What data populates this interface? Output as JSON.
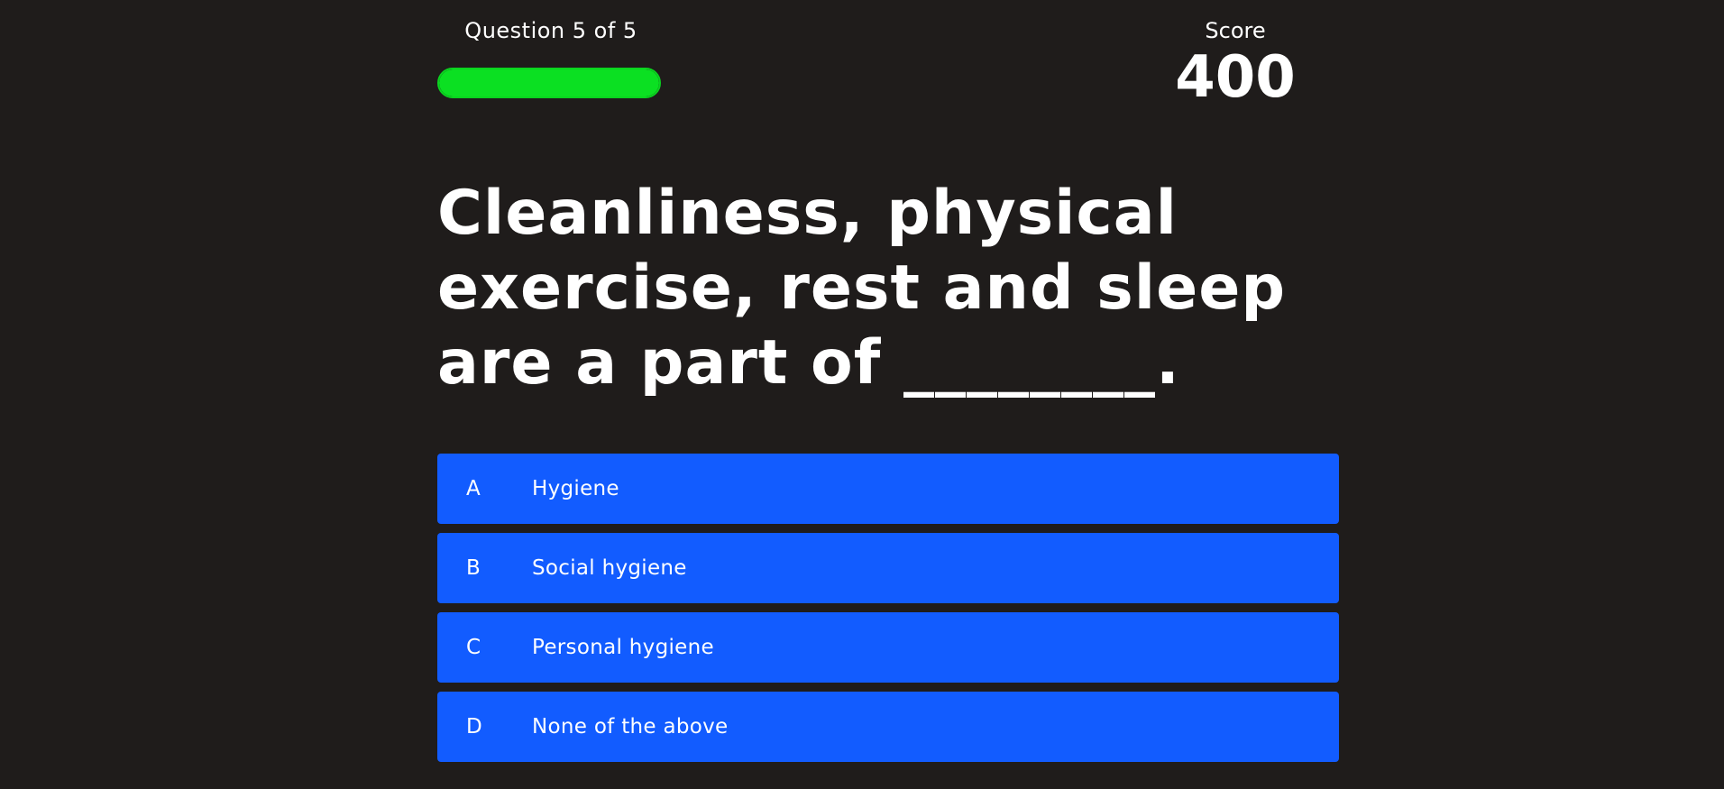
{
  "header": {
    "progress_text": "Question 5 of 5",
    "progress_fraction": 1.0,
    "progress_color": "#0be022",
    "score_label": "Score",
    "score_value": "400"
  },
  "question": {
    "text": "Cleanliness, physical exercise, rest and sleep are a part of ________."
  },
  "options": [
    {
      "letter": "A",
      "text": "Hygiene"
    },
    {
      "letter": "B",
      "text": "Social hygiene"
    },
    {
      "letter": "C",
      "text": "Personal hygiene"
    },
    {
      "letter": "D",
      "text": "None of the above"
    }
  ],
  "colors": {
    "background": "#1f1c1b",
    "option_background": "#125cff",
    "text": "#ffffff"
  }
}
